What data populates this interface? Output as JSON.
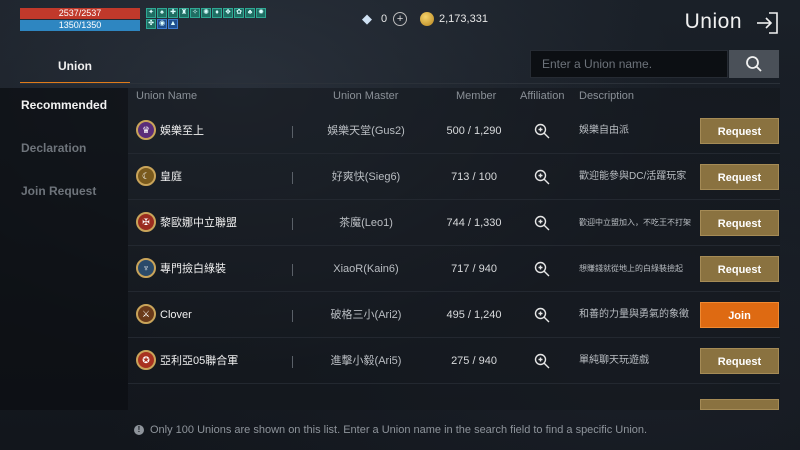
{
  "hud": {
    "hp": "2537/2537",
    "mp": "1350/1350",
    "hp_color": "#c0392b",
    "mp_color": "#2e86c1"
  },
  "currency": {
    "diamonds": "0",
    "gold": "2,173,331"
  },
  "header": {
    "title": "Union",
    "exit_icon": "exit-icon"
  },
  "tabs": {
    "union": "Union"
  },
  "search": {
    "placeholder": "Enter a Union name.",
    "icon": "search-icon"
  },
  "nav": {
    "items": [
      {
        "label": "Recommended",
        "active": true
      },
      {
        "label": "Declaration",
        "active": false
      },
      {
        "label": "Join Request",
        "active": false
      }
    ]
  },
  "table": {
    "headers": {
      "name": "Union Name",
      "master": "Union Master",
      "member": "Member",
      "affiliation": "Affiliation",
      "description": "Description"
    },
    "rows": [
      {
        "name": "娛樂至上",
        "master": "娛樂天堂(Gus2)",
        "member": "500 / 1,290",
        "description": "娛樂自由派",
        "action": "Request"
      },
      {
        "name": "皇庭",
        "master": "好爽快(Sieg6)",
        "member": "713 / 100",
        "description": "歡迎能參與DC/活躍玩家",
        "action": "Request"
      },
      {
        "name": "黎歐娜中立聯盟",
        "master": "茶魔(Leo1)",
        "member": "744 / 1,330",
        "description": "歡迎中立盟加入，不吃王不打架",
        "action": "Request"
      },
      {
        "name": "專門撿白綠裝",
        "master": "XiaoR(Kain6)",
        "member": "717 / 940",
        "description": "想賺錢就從地上的白綠裝撿起",
        "action": "Request"
      },
      {
        "name": "Clover",
        "master": "破格三小(Ari2)",
        "member": "495 / 1,240",
        "description": "和善的力量與勇氣的象徵",
        "action": "Join"
      },
      {
        "name": "亞利亞05聯合軍",
        "master": "進擊小毅(Ari5)",
        "member": "275 / 940",
        "description": "單純聊天玩遊戲",
        "action": "Request"
      }
    ]
  },
  "footer": {
    "notice": "Only 100 Unions are shown on this list. Enter a Union name in the search field to find a specific Union."
  },
  "colors": {
    "accent": "#e07b1a",
    "request_button": "#8a7240",
    "join_button": "#de6a12"
  }
}
